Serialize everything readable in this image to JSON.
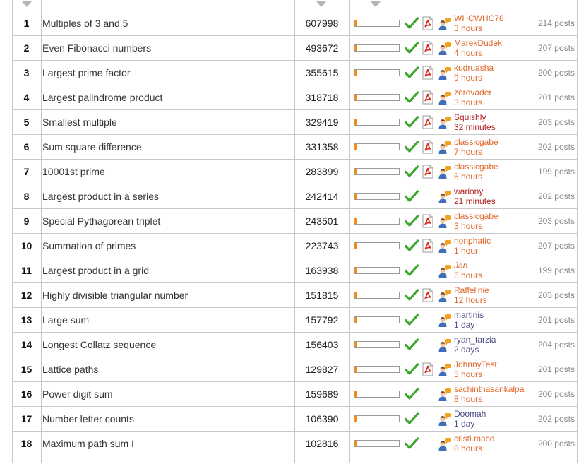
{
  "colors": {
    "accent_link": "#e0662a",
    "recent_link": "#b22222",
    "purple_link": "#4c4c8a",
    "progress_fill": "#f08c1e",
    "check_green": "#3aa62b"
  },
  "icons": {
    "sort": "triangle-down",
    "solved_mark": "green-check",
    "overview": "pdf-document",
    "last_post_user": "user-with-speech-bubble"
  },
  "problems": [
    {
      "id": "1",
      "title": "Multiples of 3 and 5",
      "solved": "607998",
      "progress": 0.05,
      "has_pdf": true,
      "user": "WHCWHC78",
      "user_style": "accent",
      "ago": "3 hours",
      "ago_style": "accent",
      "posts": "214 posts"
    },
    {
      "id": "2",
      "title": "Even Fibonacci numbers",
      "solved": "493672",
      "progress": 0.05,
      "has_pdf": true,
      "user": "MarekDudek",
      "user_style": "accent",
      "ago": "4 hours",
      "ago_style": "accent",
      "posts": "207 posts"
    },
    {
      "id": "3",
      "title": "Largest prime factor",
      "solved": "355615",
      "progress": 0.05,
      "has_pdf": true,
      "user": "kudruasha",
      "user_style": "accent",
      "ago": "9 hours",
      "ago_style": "accent",
      "posts": "200 posts"
    },
    {
      "id": "4",
      "title": "Largest palindrome product",
      "solved": "318718",
      "progress": 0.05,
      "has_pdf": true,
      "user": "zorovader",
      "user_style": "accent",
      "ago": "3 hours",
      "ago_style": "accent",
      "posts": "201 posts"
    },
    {
      "id": "5",
      "title": "Smallest multiple",
      "solved": "329419",
      "progress": 0.05,
      "has_pdf": true,
      "user": "Squishly",
      "user_style": "recent",
      "ago": "32 minutes",
      "ago_style": "recent",
      "posts": "203 posts"
    },
    {
      "id": "6",
      "title": "Sum square difference",
      "solved": "331358",
      "progress": 0.05,
      "has_pdf": true,
      "user": "classicgabe",
      "user_style": "accent",
      "ago": "7 hours",
      "ago_style": "accent",
      "posts": "202 posts"
    },
    {
      "id": "7",
      "title": "10001st prime",
      "solved": "283899",
      "progress": 0.05,
      "has_pdf": true,
      "user": "classicgabe",
      "user_style": "accent",
      "ago": "5 hours",
      "ago_style": "accent",
      "posts": "199 posts"
    },
    {
      "id": "8",
      "title": "Largest product in a series",
      "solved": "242414",
      "progress": 0.05,
      "has_pdf": false,
      "user": "warlony",
      "user_style": "recent",
      "ago": "21 minutes",
      "ago_style": "recent",
      "posts": "202 posts"
    },
    {
      "id": "9",
      "title": "Special Pythagorean triplet",
      "solved": "243501",
      "progress": 0.05,
      "has_pdf": true,
      "user": "classicgabe",
      "user_style": "accent",
      "ago": "3 hours",
      "ago_style": "accent",
      "posts": "203 posts"
    },
    {
      "id": "10",
      "title": "Summation of primes",
      "solved": "223743",
      "progress": 0.05,
      "has_pdf": true,
      "user": "nonphatic",
      "user_style": "accent",
      "ago": "1 hour",
      "ago_style": "accent",
      "posts": "207 posts"
    },
    {
      "id": "11",
      "title": "Largest product in a grid",
      "solved": "163938",
      "progress": 0.05,
      "has_pdf": false,
      "user": "Jan",
      "user_style": "accent-italic",
      "ago": "5 hours",
      "ago_style": "accent",
      "posts": "199 posts"
    },
    {
      "id": "12",
      "title": "Highly divisible triangular number",
      "solved": "151815",
      "progress": 0.05,
      "has_pdf": true,
      "user": "Raffelinie",
      "user_style": "accent",
      "ago": "12 hours",
      "ago_style": "accent",
      "posts": "203 posts"
    },
    {
      "id": "13",
      "title": "Large sum",
      "solved": "157792",
      "progress": 0.05,
      "has_pdf": false,
      "user": "martinis",
      "user_style": "purple",
      "ago": "1 day",
      "ago_style": "purple",
      "posts": "201 posts"
    },
    {
      "id": "14",
      "title": "Longest Collatz sequence",
      "solved": "156403",
      "progress": 0.05,
      "has_pdf": false,
      "user": "ryan_tarzia",
      "user_style": "purple",
      "ago": "2 days",
      "ago_style": "purple",
      "posts": "204 posts"
    },
    {
      "id": "15",
      "title": "Lattice paths",
      "solved": "129827",
      "progress": 0.05,
      "has_pdf": true,
      "user": "JohnnyTest",
      "user_style": "accent",
      "ago": "5 hours",
      "ago_style": "accent",
      "posts": "201 posts"
    },
    {
      "id": "16",
      "title": "Power digit sum",
      "solved": "159689",
      "progress": 0.05,
      "has_pdf": false,
      "user": "sachinthasankalpa",
      "user_style": "accent",
      "ago": "8 hours",
      "ago_style": "accent",
      "posts": "200 posts"
    },
    {
      "id": "17",
      "title": "Number letter counts",
      "solved": "106390",
      "progress": 0.05,
      "has_pdf": false,
      "user": "Doomah",
      "user_style": "purple",
      "ago": "1 day",
      "ago_style": "purple",
      "posts": "202 posts"
    },
    {
      "id": "18",
      "title": "Maximum path sum I",
      "solved": "102816",
      "progress": 0.05,
      "has_pdf": false,
      "user": "cristi.maco",
      "user_style": "accent",
      "ago": "8 hours",
      "ago_style": "accent",
      "posts": "200 posts"
    }
  ]
}
